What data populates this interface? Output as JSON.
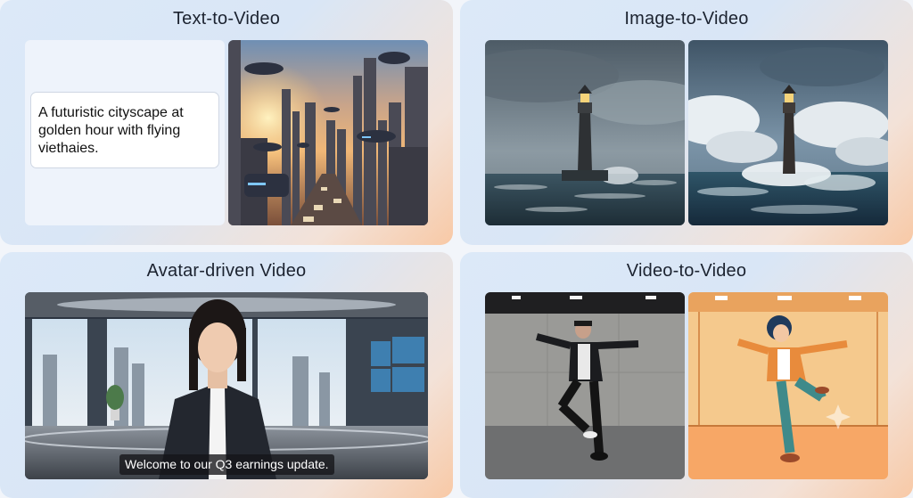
{
  "cards": {
    "t2v": {
      "title": "Text-to-Video",
      "prompt": "A futuristic cityscape at golden hour with flying viethaies."
    },
    "i2v": {
      "title": "Image-to-Video"
    },
    "avatar": {
      "title": "Avatar-driven Video",
      "caption": "Welcome to our Q3 earnings update."
    },
    "v2v": {
      "title": "Video-to-Video"
    }
  },
  "colors": {
    "card_gradient_start": "#dce9f8",
    "card_gradient_end": "#f8c9a6",
    "title_text": "#1c2330"
  }
}
